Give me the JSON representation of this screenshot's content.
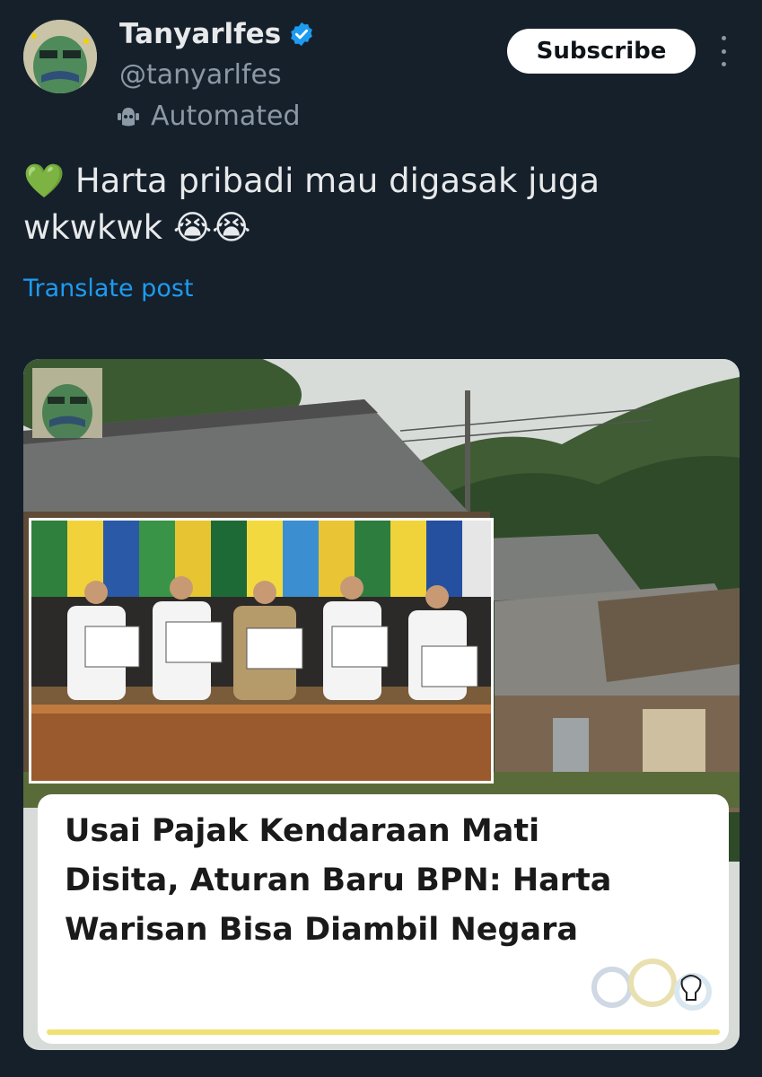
{
  "header": {
    "display_name": "Tanyarlfes",
    "handle": "@tanyarlfes",
    "automated_label": "Automated",
    "subscribe_label": "Subscribe"
  },
  "post": {
    "text_line1": "Harta pribadi mau digasak juga",
    "text_line2": "wkwkwk",
    "emoji_heart": "💚",
    "emoji_cry": "😭😭",
    "translate_label": "Translate post"
  },
  "media": {
    "headline_line1": "Usai Pajak Kendaraan Mati",
    "headline_line2": "Disita, Aturan Baru BPN: Harta",
    "headline_line3": "Warisan Bisa Diambil Negara"
  },
  "colors": {
    "background": "#15202b",
    "link": "#1d9bf0",
    "verified": "#1d9bf0",
    "secondary_text": "#8b98a5"
  },
  "icons": [
    "verified-badge-icon",
    "robot-icon",
    "more-options-icon"
  ]
}
